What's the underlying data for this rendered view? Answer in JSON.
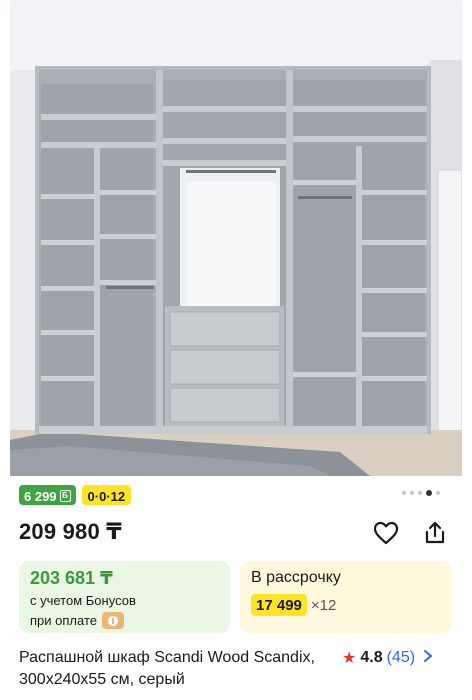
{
  "product": {
    "image_alt": "Распашной шкаф Scandi Wood Scandix",
    "gallery_dots_total": 5,
    "gallery_dots_active": 4,
    "badge_bonus": "6 299",
    "badge_bonus_icon": "Б",
    "badge_installment": "0·0·12",
    "price": "209 980 ₸",
    "title": "Распашной шкаф Scandi Wood Scandix, 300x240x55 см, серый",
    "rating": "4.8",
    "reviews": "(45)"
  },
  "bonus_card": {
    "price": "203 681 ₸",
    "line1": "с учетом Бонусов",
    "line2": "при оплате"
  },
  "installment_card": {
    "title": "В рассрочку",
    "amount": "17 499",
    "term": "×12"
  },
  "colors": {
    "bonus_green": "#3fa33f",
    "accent_yellow": "#ffe32a",
    "star_red": "#e0382e",
    "link_blue": "#2a6fd6"
  },
  "icons": [
    "favorite-heart-icon",
    "share-icon",
    "star-icon",
    "chevron-right-icon",
    "kaspi-logo-icon"
  ]
}
